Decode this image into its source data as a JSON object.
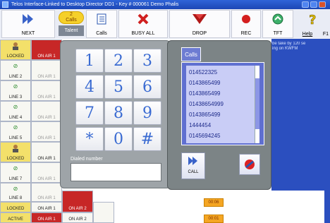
{
  "window": {
    "title": "Telos Interface-Linked to Desktop Director DD1 - Key # 000061 Demo Phalis"
  },
  "toolbar": {
    "next_label": "NEXT",
    "calls_count": "2",
    "calls_tab_label": "Calls",
    "talent_label": "Talent",
    "calls_label": "Calls",
    "busy_all_label": "BUSY ALL",
    "drop_label": "DROP",
    "rec_label": "REC",
    "tft_label": "TFT",
    "help_label": "Help",
    "f1_label": "F1"
  },
  "lines": {
    "locked_label": "LOCKED",
    "on_air1_label": "ON AIR 1",
    "on_air2_label": "ON AIR 2",
    "line2": "LINE 2",
    "line3": "LINE 3",
    "line4": "LINE 4",
    "line5": "LINE 5",
    "line7": "LINE 7",
    "line8": "LINE 8",
    "active_label": "ACTIVE"
  },
  "dialer": {
    "keys": [
      "1",
      "2",
      "3",
      "4",
      "5",
      "6",
      "7",
      "8",
      "9",
      "*",
      "0",
      "#"
    ],
    "dialed_label": "Dialed number",
    "dialed_value": ""
  },
  "calls_panel": {
    "tab_label": "Calls",
    "numbers": [
      "014522325",
      "0143865499",
      "0143865499",
      "01438654999",
      "0143865499",
      "1444454",
      "0145694245"
    ],
    "call_label": "CALL"
  },
  "notice": {
    "line1": "be take by 120 se",
    "line2": "ing on KWFM"
  },
  "timers": [
    "00:06",
    "00:01"
  ],
  "colors": {
    "title_blue": "#1c46b5",
    "onair_red": "#c72727",
    "locked_yellow": "#f3e06a",
    "timer_orange": "#f5a623",
    "list_blue": "#5f6fd0"
  }
}
